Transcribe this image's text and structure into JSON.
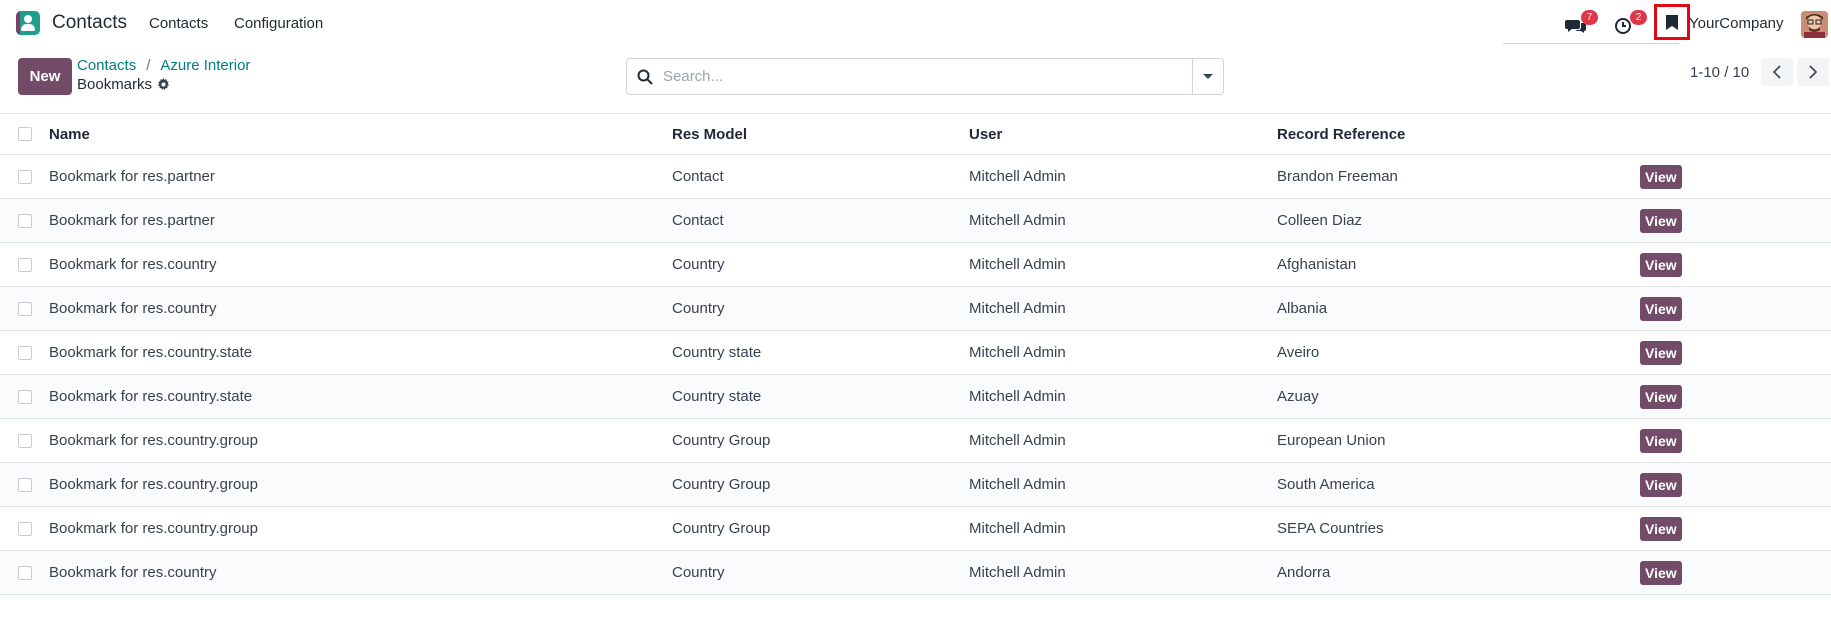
{
  "navbar": {
    "app_title": "Contacts",
    "menu": [
      "Contacts",
      "Configuration"
    ],
    "chat_badge": "7",
    "activity_badge": "2",
    "company": "YourCompany",
    "accent_color": "#714b67",
    "badge_color": "#e0364a",
    "highlight_color": "#e30613"
  },
  "control_panel": {
    "new_label": "New",
    "breadcrumb": [
      "Contacts",
      "Azure Interior"
    ],
    "breadcrumb_separator": "/",
    "page_title": "Bookmarks",
    "search_placeholder": "Search...",
    "pager": "1-10 / 10"
  },
  "table": {
    "columns": [
      "Name",
      "Res Model",
      "User",
      "Record Reference"
    ],
    "action_label": "View",
    "rows": [
      {
        "name": "Bookmark for res.partner",
        "model": "Contact",
        "user": "Mitchell Admin",
        "ref": "Brandon Freeman"
      },
      {
        "name": "Bookmark for res.partner",
        "model": "Contact",
        "user": "Mitchell Admin",
        "ref": "Colleen Diaz"
      },
      {
        "name": "Bookmark for res.country",
        "model": "Country",
        "user": "Mitchell Admin",
        "ref": "Afghanistan"
      },
      {
        "name": "Bookmark for res.country",
        "model": "Country",
        "user": "Mitchell Admin",
        "ref": "Albania"
      },
      {
        "name": "Bookmark for res.country.state",
        "model": "Country state",
        "user": "Mitchell Admin",
        "ref": "Aveiro"
      },
      {
        "name": "Bookmark for res.country.state",
        "model": "Country state",
        "user": "Mitchell Admin",
        "ref": "Azuay"
      },
      {
        "name": "Bookmark for res.country.group",
        "model": "Country Group",
        "user": "Mitchell Admin",
        "ref": "European Union"
      },
      {
        "name": "Bookmark for res.country.group",
        "model": "Country Group",
        "user": "Mitchell Admin",
        "ref": "South America"
      },
      {
        "name": "Bookmark for res.country.group",
        "model": "Country Group",
        "user": "Mitchell Admin",
        "ref": "SEPA Countries"
      },
      {
        "name": "Bookmark for res.country",
        "model": "Country",
        "user": "Mitchell Admin",
        "ref": "Andorra"
      }
    ]
  }
}
